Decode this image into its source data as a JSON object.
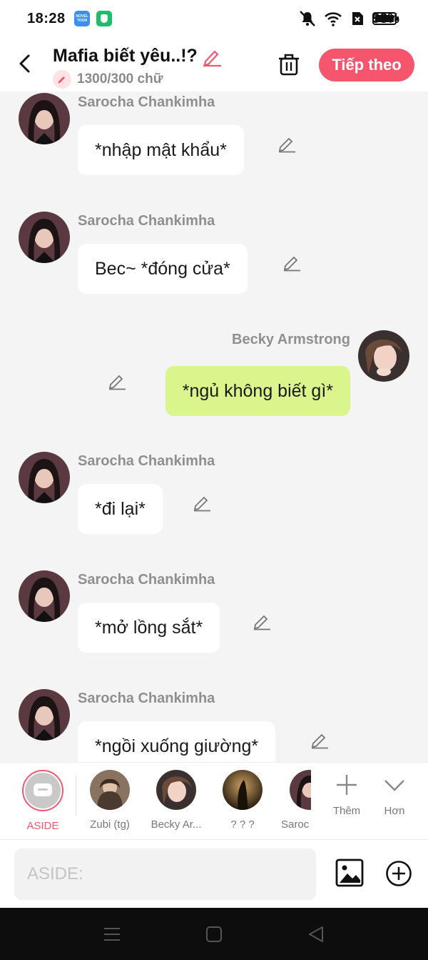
{
  "status_bar": {
    "time": "18:28",
    "battery": "93%",
    "novel_app_label": "NOVEL TOON"
  },
  "header": {
    "title": "Mafia biết yêu..!?",
    "word_count": "1300/300 chữ",
    "next_label": "Tiếp theo"
  },
  "messages": [
    {
      "sender": "Sarocha Chankimha",
      "text": "*nhập mật khẩu*",
      "side": "left"
    },
    {
      "sender": "Sarocha Chankimha",
      "text": "Bec~ *đóng cửa*",
      "side": "left"
    },
    {
      "sender": "Becky Armstrong",
      "text": "*ngủ không biết gì*",
      "side": "right"
    },
    {
      "sender": "Sarocha Chankimha",
      "text": "*đi lại*",
      "side": "left"
    },
    {
      "sender": "Sarocha Chankimha",
      "text": "*mở lồng sắt*",
      "side": "left"
    },
    {
      "sender": "Sarocha Chankimha",
      "text": "*ngồi xuống giường*",
      "side": "left"
    }
  ],
  "characters": [
    {
      "label": "ASIDE"
    },
    {
      "label": "Zubi (tg)"
    },
    {
      "label": "Becky Ar..."
    },
    {
      "label": "? ? ?"
    },
    {
      "label": "Saroc"
    }
  ],
  "tools": {
    "add_label": "Thêm",
    "more_label": "Hơn"
  },
  "composer": {
    "placeholder": "ASIDE:"
  },
  "colors": {
    "accent": "#f5566d",
    "right_bubble": "#d9f58b"
  }
}
